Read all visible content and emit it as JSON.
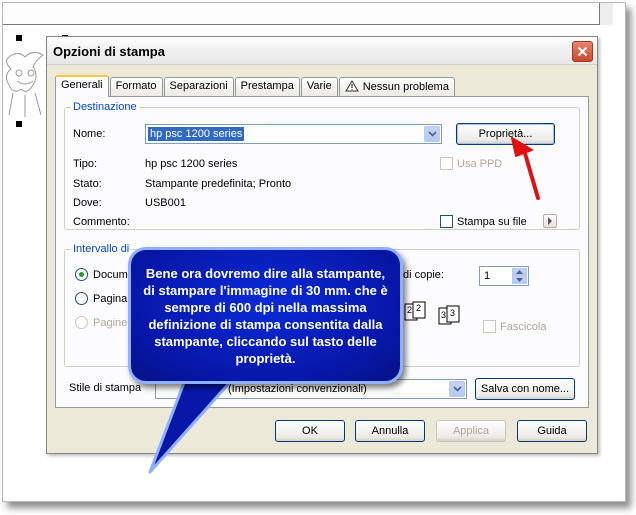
{
  "dialog": {
    "title": "Opzioni di stampa",
    "tabs": [
      {
        "label": "Generali",
        "active": true
      },
      {
        "label": "Formato",
        "active": false
      },
      {
        "label": "Separazioni",
        "active": false
      },
      {
        "label": "Prestampa",
        "active": false
      },
      {
        "label": "Varie",
        "active": false
      },
      {
        "label": "Nessun problema",
        "active": false,
        "icon": "warning-icon"
      }
    ],
    "destination": {
      "legend": "Destinazione",
      "name_label": "Nome:",
      "name_value": "hp psc 1200 series",
      "properties_button": "Proprietà...",
      "type_label": "Tipo:",
      "type_value": "hp psc 1200 series",
      "use_ppd_label": "Usa PPD",
      "status_label": "Stato:",
      "status_value": "Stampante predefinita; Pronto",
      "where_label": "Dove:",
      "where_value": "USB001",
      "comment_label": "Commento:",
      "print_to_file_label": "Stampa su file"
    },
    "range": {
      "legend": "Intervallo di",
      "document_option": "Docume",
      "page_option": "Pagina c",
      "pages_option": "Pagine:",
      "copies_label": "di copie:",
      "copies_value": "1",
      "collate_label": "Fascicola",
      "collate_icons": [
        "2",
        "2",
        "3",
        "3"
      ]
    },
    "print_style_label": "Stile di stampa",
    "print_style_value": "(Impostazioni convenzionali)",
    "save_as_button": "Salva con nome...",
    "buttons": {
      "ok": "OK",
      "cancel": "Annulla",
      "apply": "Applica",
      "help": "Guida"
    }
  },
  "callout": {
    "text": "Bene ora dovremo dire alla stampante, di stampare l'immagine di 30 mm. che è sempre di 600 dpi nella massima definizione di stampa consentita dalla stampante, cliccando sul tasto delle proprietà."
  },
  "colors": {
    "callout_fill": "#0717a8",
    "callout_border": "#8fb0ff",
    "pointer_arrow": "#e01010",
    "group_legend": "#0046d5",
    "selection_highlight": "#316ac5"
  }
}
